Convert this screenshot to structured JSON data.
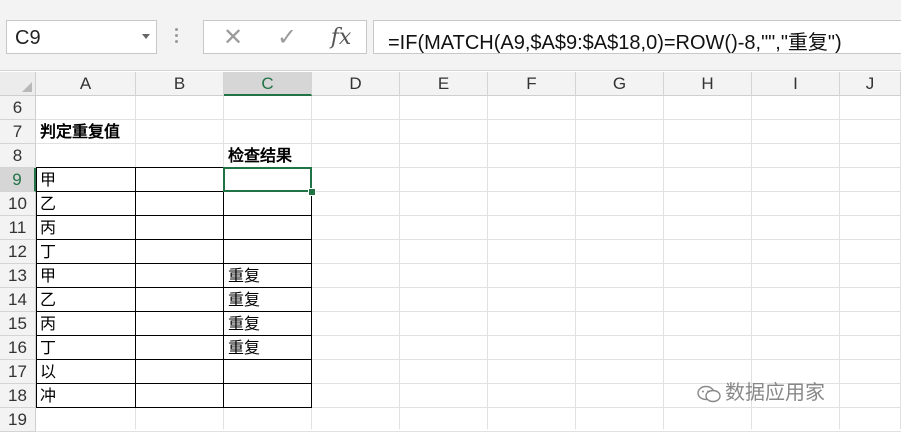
{
  "formula_bar": {
    "name_box": "C9",
    "cancel_glyph": "✕",
    "enter_glyph": "✓",
    "fx_label": "fx",
    "formula": "=IF(MATCH(A9,$A$9:$A$18,0)=ROW()-8,\"\",\"重复\")"
  },
  "columns": [
    "A",
    "B",
    "C",
    "D",
    "E",
    "F",
    "G",
    "H",
    "I",
    "J"
  ],
  "rows": [
    "6",
    "7",
    "8",
    "9",
    "10",
    "11",
    "12",
    "13",
    "14",
    "15",
    "16",
    "17",
    "18",
    "19"
  ],
  "active_cell": {
    "column": "C",
    "row": "9"
  },
  "cells": {
    "A7": "判定重复值",
    "C8": "检查结果",
    "A9": "甲",
    "A10": "乙",
    "A11": "丙",
    "A12": "丁",
    "A13": "甲",
    "A14": "乙",
    "A15": "丙",
    "A16": "丁",
    "A17": "以",
    "A18": "冲",
    "C13": "重复",
    "C14": "重复",
    "C15": "重复",
    "C16": "重复"
  },
  "watermark": "数据应用家",
  "colors": {
    "accent": "#217346",
    "header_bg": "#f3f3f3",
    "header_active_bg": "#d6d6d6",
    "gridline": "#e1e1e1"
  },
  "icons": [
    "dropdown-arrow-icon",
    "more-options-icon",
    "cancel-icon",
    "enter-check-icon",
    "function-icon",
    "wechat-icon"
  ]
}
